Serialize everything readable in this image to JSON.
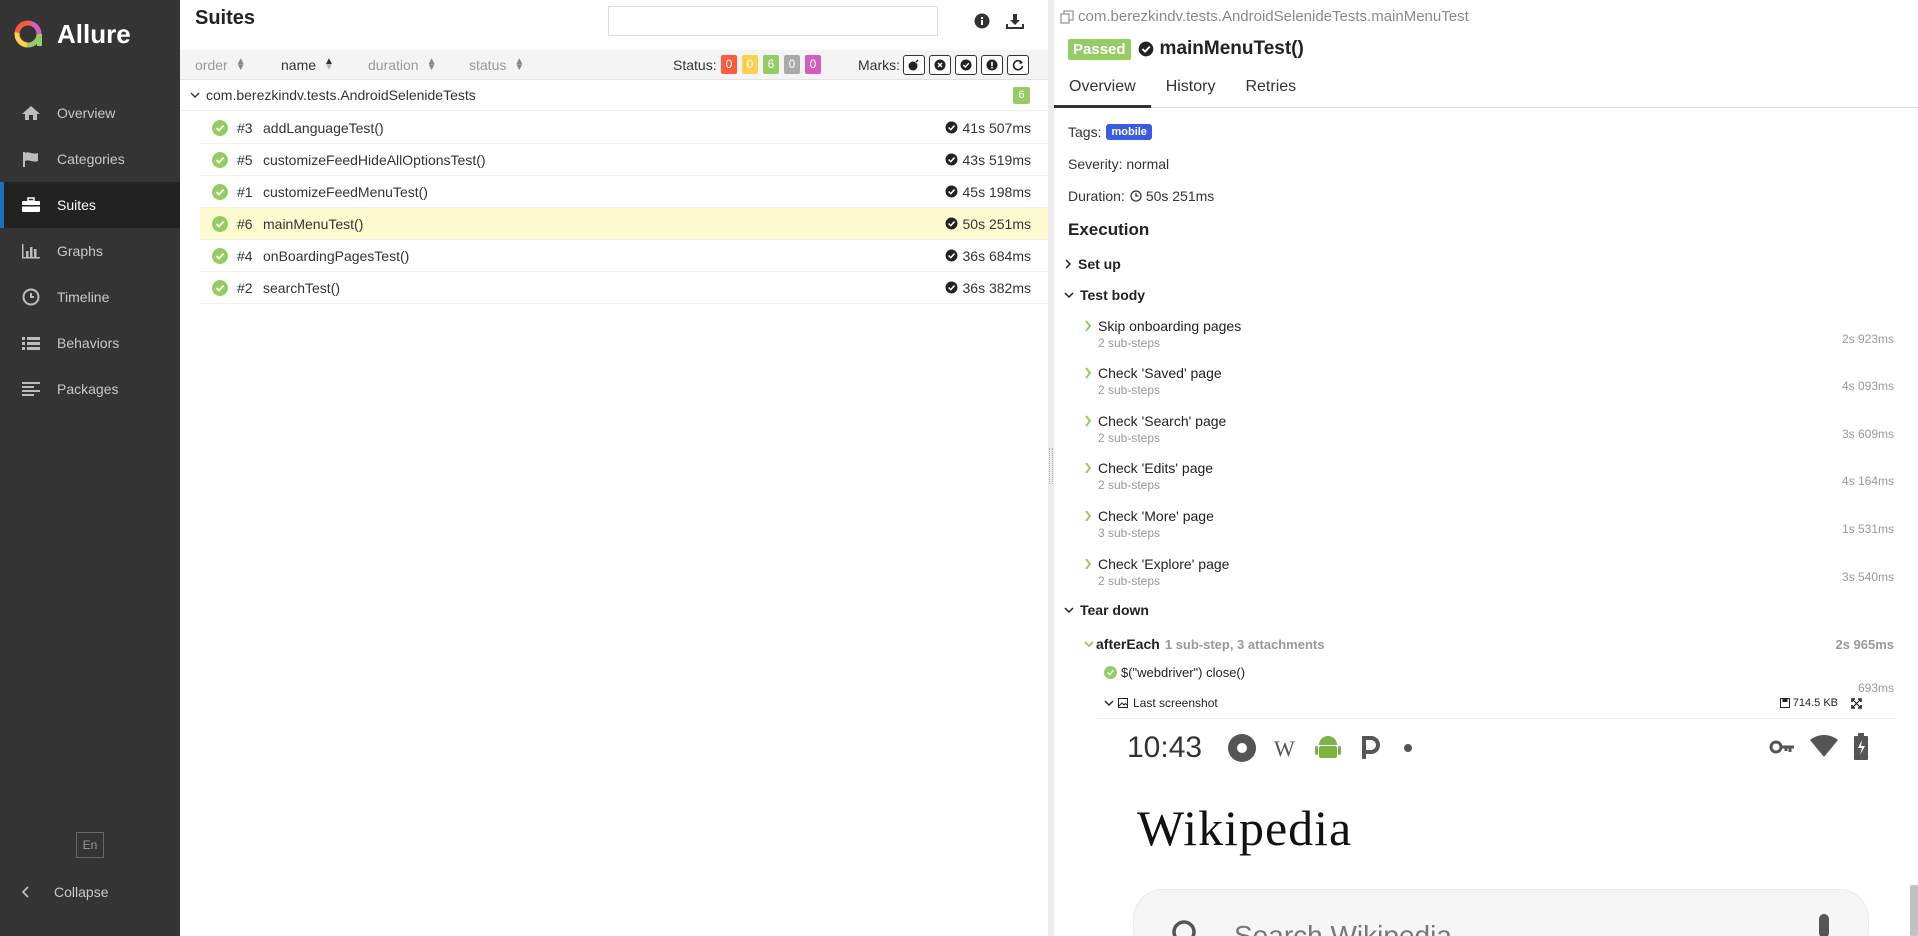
{
  "app": {
    "name": "Allure"
  },
  "colors": {
    "sidebar_bg": "#343434",
    "passed": "#97cc64",
    "failed": "#fd5a3e",
    "broken": "#ffd050",
    "skipped": "#aaaaaa",
    "unknown": "#d35ebe",
    "tag_bg": "#3a5bde",
    "selected_row": "#fffbd0"
  },
  "sidebar": {
    "items": [
      {
        "label": "Overview",
        "icon": "home-icon"
      },
      {
        "label": "Categories",
        "icon": "flag-icon"
      },
      {
        "label": "Suites",
        "icon": "briefcase-icon"
      },
      {
        "label": "Graphs",
        "icon": "bar-chart-icon"
      },
      {
        "label": "Timeline",
        "icon": "clock-icon"
      },
      {
        "label": "Behaviors",
        "icon": "list-icon"
      },
      {
        "label": "Packages",
        "icon": "align-left-icon"
      }
    ],
    "active": "Suites",
    "language": "En",
    "collapse_label": "Collapse"
  },
  "suites": {
    "title": "Suites",
    "search_placeholder": "",
    "sort": {
      "order": "order",
      "name": "name",
      "duration": "duration",
      "status": "status"
    },
    "status_label": "Status:",
    "status_counts": {
      "failed": "0",
      "broken": "0",
      "passed": "6",
      "skipped": "0",
      "unknown": "0"
    },
    "marks_label": "Marks:",
    "group": {
      "name": "com.berezkindv.tests.AndroidSelenideTests",
      "count": "6"
    },
    "rows": [
      {
        "num": "#3",
        "name": "addLanguageTest()",
        "duration": "41s 507ms"
      },
      {
        "num": "#5",
        "name": "customizeFeedHideAllOptionsTest()",
        "duration": "43s 519ms"
      },
      {
        "num": "#1",
        "name": "customizeFeedMenuTest()",
        "duration": "45s 198ms"
      },
      {
        "num": "#6",
        "name": "mainMenuTest()",
        "duration": "50s 251ms"
      },
      {
        "num": "#4",
        "name": "onBoardingPagesTest()",
        "duration": "36s 684ms"
      },
      {
        "num": "#2",
        "name": "searchTest()",
        "duration": "36s 382ms"
      }
    ]
  },
  "result": {
    "breadcrumb": "com.berezkindv.tests.AndroidSelenideTests.mainMenuTest",
    "status": "Passed",
    "title": "mainMenuTest()",
    "tabs": [
      "Overview",
      "History",
      "Retries"
    ],
    "tags_label": "Tags:",
    "tag": "mobile",
    "severity": "Severity: normal",
    "duration_label": "Duration:",
    "duration": "50s 251ms",
    "execution_title": "Execution",
    "setup_label": "Set up",
    "body_label": "Test body",
    "steps": [
      {
        "name": "Skip onboarding pages",
        "sub": "2 sub-steps",
        "duration": "2s 923ms"
      },
      {
        "name": "Check 'Saved' page",
        "sub": "2 sub-steps",
        "duration": "4s 093ms"
      },
      {
        "name": "Check 'Search' page",
        "sub": "2 sub-steps",
        "duration": "3s 609ms"
      },
      {
        "name": "Check 'Edits' page",
        "sub": "2 sub-steps",
        "duration": "4s 164ms"
      },
      {
        "name": "Check 'More' page",
        "sub": "3 sub-steps",
        "duration": "1s 531ms"
      },
      {
        "name": "Check 'Explore' page",
        "sub": "2 sub-steps",
        "duration": "3s 540ms"
      }
    ],
    "teardown_label": "Tear down",
    "after_each": {
      "name": "afterEach",
      "meta": "1 sub-step, 3 attachments",
      "duration": "2s 965ms"
    },
    "sub_step": {
      "name": "$(\"webdriver\") close()",
      "duration": "693ms"
    },
    "attachment": {
      "name": "Last screenshot",
      "size": "714.5 KB"
    },
    "screenshot": {
      "time": "10:43",
      "wiki_logo": "Wikipedia",
      "search_placeholder": "Search Wikipedia"
    }
  }
}
